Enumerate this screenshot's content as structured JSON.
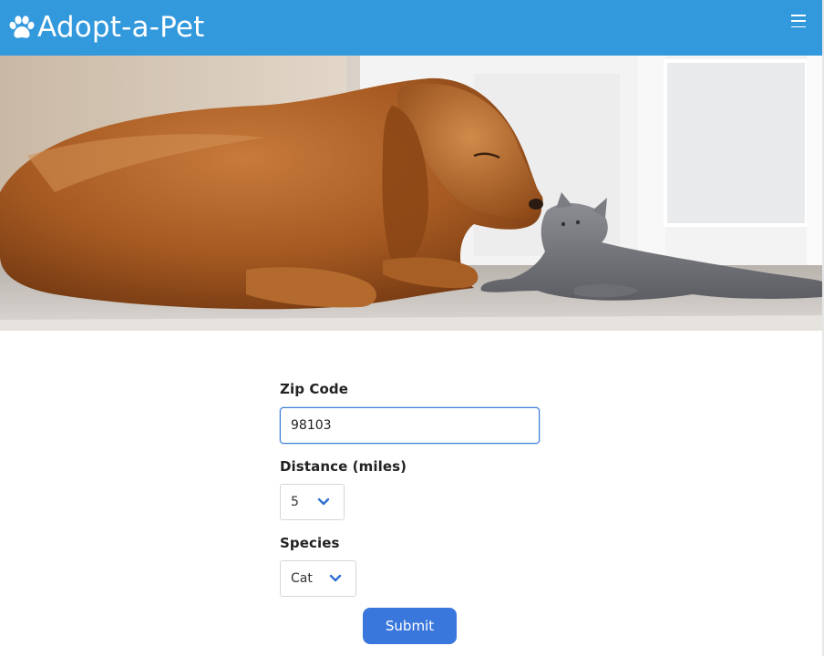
{
  "header": {
    "brand_text": "Adopt-a-Pet",
    "brand_icon": "paw-icon",
    "menu_icon": "hamburger-menu-icon",
    "background_color": "#3399dd"
  },
  "hero": {
    "icon": "dog-and-kitten-photo"
  },
  "form": {
    "zip": {
      "label": "Zip Code",
      "value": "98103"
    },
    "distance": {
      "label": "Distance (miles)",
      "selected": "5"
    },
    "species": {
      "label": "Species",
      "selected": "Cat"
    },
    "submit_label": "Submit",
    "accent_color": "#3a77dd"
  }
}
